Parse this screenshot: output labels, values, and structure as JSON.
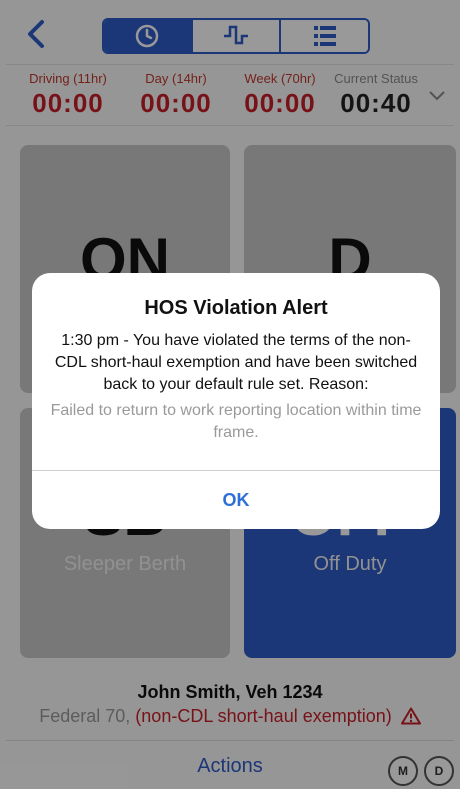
{
  "nav": {
    "tabs": [
      {
        "icon": "clock-icon",
        "active": true
      },
      {
        "icon": "graph-icon",
        "active": false
      },
      {
        "icon": "list-icon",
        "active": false
      }
    ]
  },
  "timers": [
    {
      "label": "Driving (11hr)",
      "value": "00:00"
    },
    {
      "label": "Day (14hr)",
      "value": "00:00"
    },
    {
      "label": "Week (70hr)",
      "value": "00:00"
    },
    {
      "label": "Current Status",
      "value": "00:40"
    }
  ],
  "tiles": [
    {
      "code": "ON",
      "label": ""
    },
    {
      "code": "D",
      "label": ""
    },
    {
      "code": "SB",
      "label": "Sleeper Berth"
    },
    {
      "code": "OFF",
      "label": "Off Duty"
    }
  ],
  "driver": {
    "line": "John Smith, Veh 1234",
    "ruleset": "Federal 70, ",
    "exemption": "(non-CDL short-haul exemption)"
  },
  "footer": {
    "actions_label": "Actions",
    "m_label": "M",
    "d_label": "D"
  },
  "dialog": {
    "title": "HOS Violation Alert",
    "message": "1:30 pm - You have violated the terms of the non-CDL short-haul exemption and have been switched back to your default rule set. Reason:",
    "reason": "Failed to return to work reporting location within time frame.",
    "ok_label": "OK"
  },
  "colors": {
    "accent": "#2d5cc6",
    "alert_red": "#c71f28",
    "tile_grey": "#c9c9c9"
  }
}
